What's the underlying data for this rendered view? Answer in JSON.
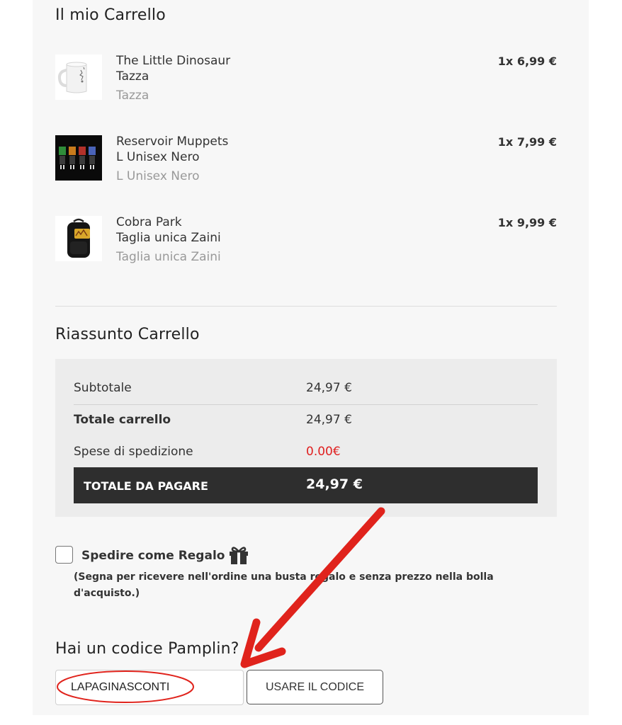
{
  "cart": {
    "title": "Il mio Carrello",
    "items": [
      {
        "name": "The Little Dinosaur",
        "variant": "Tazza",
        "subtitle": "Tazza",
        "price": "1x 6,99 €",
        "thumb_icon": "mug-icon"
      },
      {
        "name": "Reservoir Muppets",
        "variant": "L Unisex Nero",
        "subtitle": "L Unisex Nero",
        "price": "1x 7,99 €",
        "thumb_icon": "tshirt-print-icon"
      },
      {
        "name": "Cobra Park",
        "variant": "Taglia unica Zaini",
        "subtitle": "Taglia unica Zaini",
        "price": "1x 9,99 €",
        "thumb_icon": "backpack-icon"
      }
    ]
  },
  "summary": {
    "title": "Riassunto Carrello",
    "subtotal_label": "Subtotale",
    "subtotal_value": "24,97 €",
    "cart_total_label": "Totale carrello",
    "cart_total_value": "24,97 €",
    "shipping_label": "Spese di spedizione",
    "shipping_value": "0.00€",
    "pay_total_label": "TOTALE DA PAGARE",
    "pay_total_value": "24,97 €"
  },
  "gift": {
    "label": "Spedire come Regalo",
    "checked": false,
    "note": "(Segna per ricevere nell'ordine una busta regalo e senza prezzo nella bolla d'acquisto.)",
    "icon": "gift-icon"
  },
  "promo": {
    "title": "Hai un codice Pamplin?",
    "input_value": "LAPAGINASCONTI",
    "button_label": "USARE IL CODICE"
  },
  "colors": {
    "shipping_free": "#e02020",
    "total_bar": "#2e2e2e",
    "annotation_red": "#e0231c"
  }
}
